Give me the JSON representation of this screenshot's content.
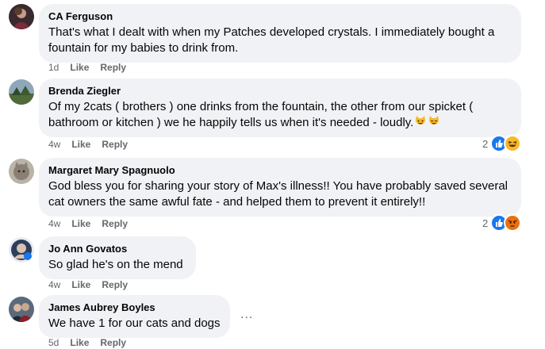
{
  "comments": [
    {
      "author": "CA Ferguson",
      "text": "That's what I dealt with when my Patches developed crystals. I immediately bought a fountain for my babies to drink from.",
      "time": "1d",
      "like": "Like",
      "reply": "Reply"
    },
    {
      "author": "Brenda Ziegler",
      "text": "Of my 2cats ( brothers ) one drinks from the fountain, the other from our spicket ( bathroom or kitchen ) we he happily tells us when it's needed - loudly.",
      "time": "4w",
      "like": "Like",
      "reply": "Reply",
      "reaction_count": "2",
      "reactions": [
        "like-icon",
        "haha-icon"
      ]
    },
    {
      "author": "Margaret Mary Spagnuolo",
      "text": "God bless you for sharing your story of Max's illness!! You have probably saved several cat owners the same awful fate - and helped them to prevent it entirely!!",
      "time": "4w",
      "like": "Like",
      "reply": "Reply",
      "reaction_count": "2",
      "reactions": [
        "like-icon",
        "angry-icon"
      ]
    },
    {
      "author": "Jo Ann Govatos",
      "text": "So glad he's on the mend",
      "time": "4w",
      "like": "Like",
      "reply": "Reply"
    },
    {
      "author": "James Aubrey Boyles",
      "text": "We have 1 for our cats and dogs",
      "time": "5d",
      "like": "Like",
      "reply": "Reply"
    }
  ],
  "more_options": "...",
  "colors": {
    "bubble": "#f0f2f5",
    "meta": "#65676b",
    "like_blue": "#1877f2",
    "haha_yellow": "#f7b928",
    "angry_red": "#e9710f"
  }
}
